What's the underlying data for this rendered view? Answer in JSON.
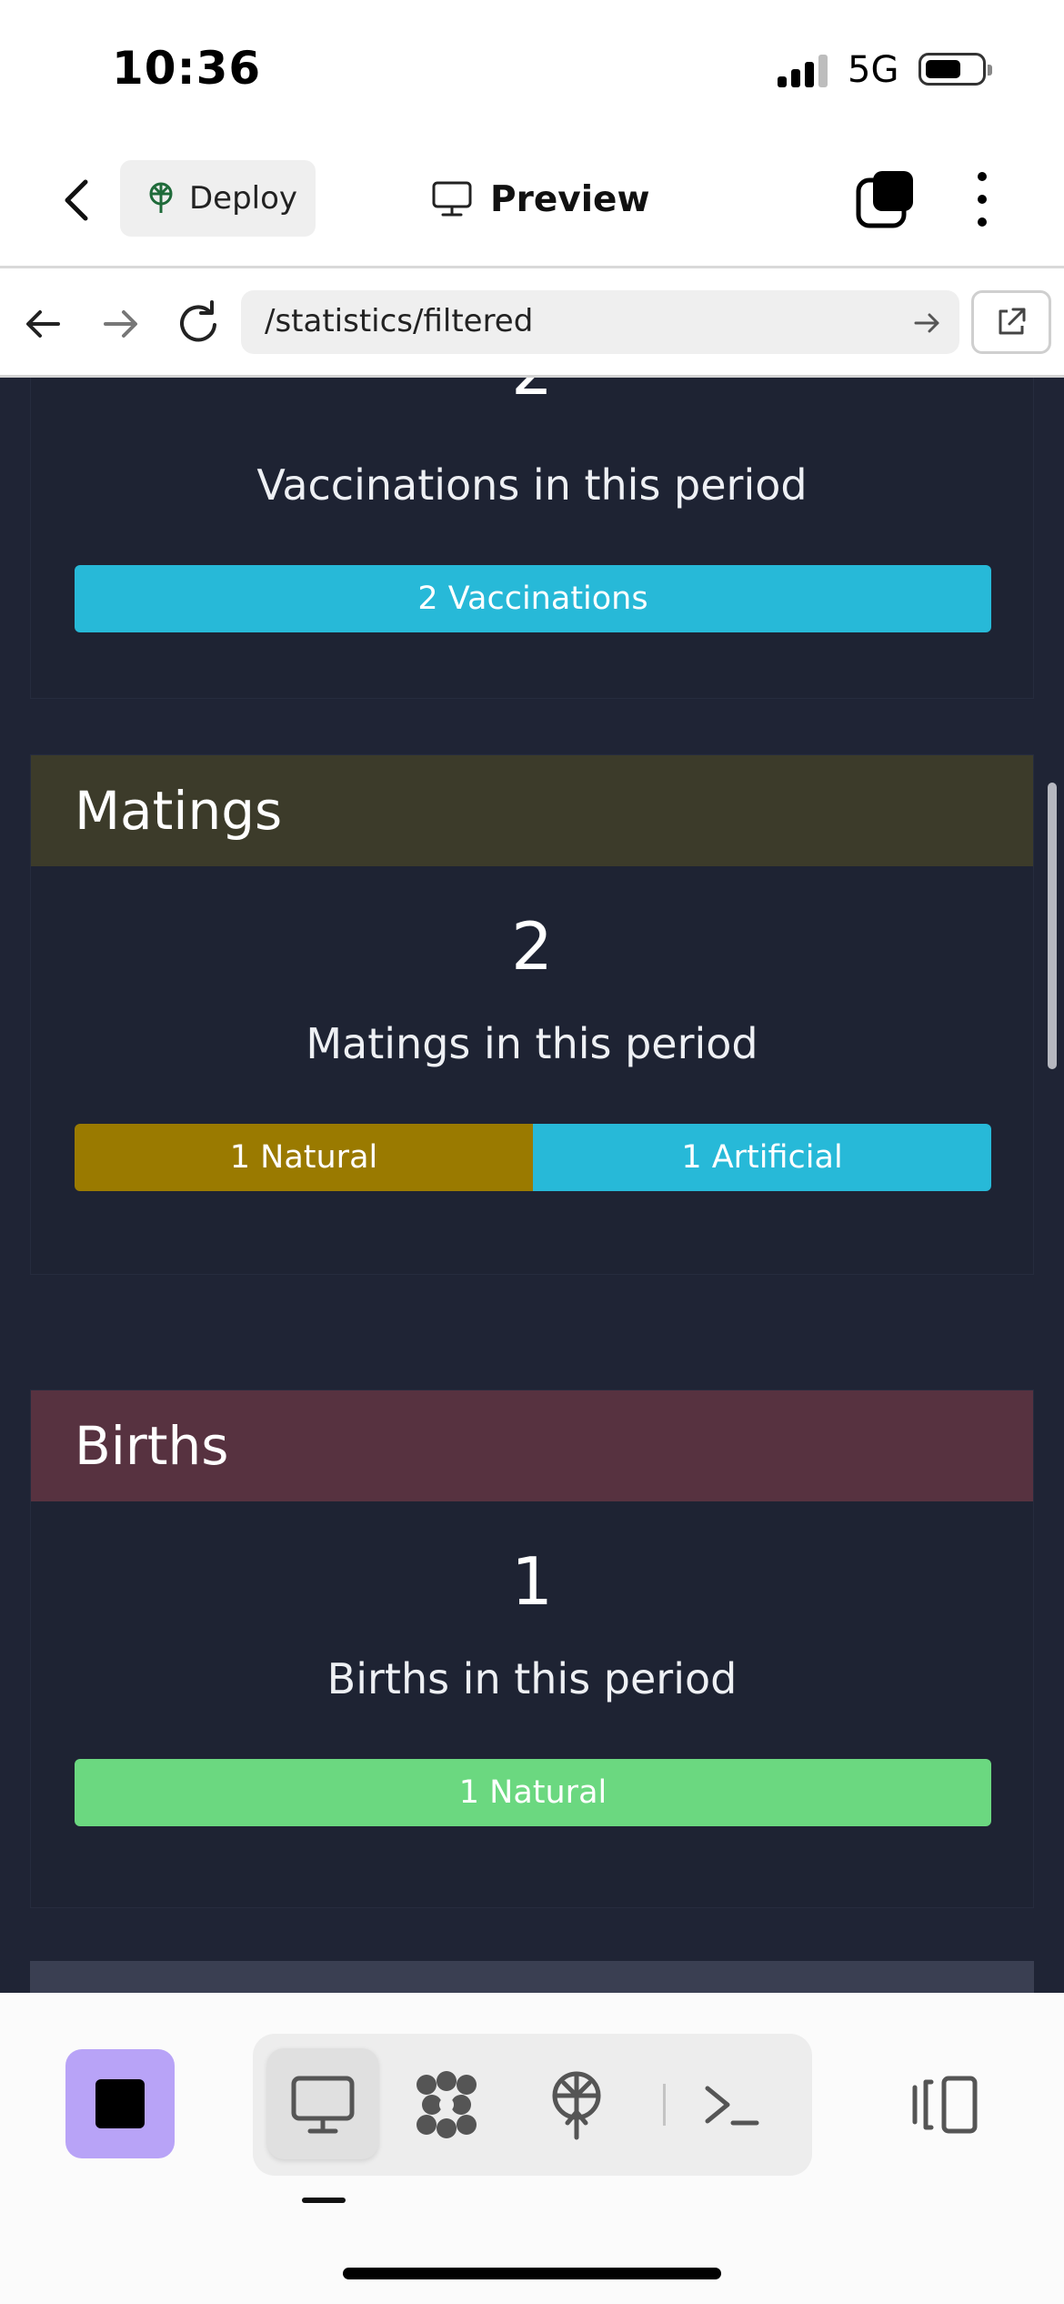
{
  "status_bar": {
    "time": "10:36",
    "network": "5G",
    "battery_level": 0.6
  },
  "app_header": {
    "back_icon": "chevron-left-icon",
    "deploy_label": "Deploy",
    "preview_label": "Preview"
  },
  "browser": {
    "url": "/statistics/filtered"
  },
  "sections": {
    "vaccinations": {
      "value": "2",
      "caption": "Vaccinations in this period",
      "segments": [
        {
          "label": "2 Vaccinations",
          "fraction": 1.0,
          "color": "#27b9d8"
        }
      ]
    },
    "matings": {
      "title": "Matings",
      "header_color": "#3c3b2a",
      "value": "2",
      "caption": "Matings in this period",
      "segments": [
        {
          "label": "1 Natural",
          "fraction": 0.5,
          "color": "#9a7a00"
        },
        {
          "label": "1 Artificial",
          "fraction": 0.5,
          "color": "#27b9d8"
        }
      ]
    },
    "births": {
      "title": "Births",
      "header_color": "#573240",
      "value": "1",
      "caption": "Births in this period",
      "segments": [
        {
          "label": "1 Natural",
          "fraction": 1.0,
          "color": "#6bd880"
        }
      ]
    }
  },
  "colors": {
    "content_background": "#1f2435",
    "stop_button": "#b8a3f7"
  }
}
